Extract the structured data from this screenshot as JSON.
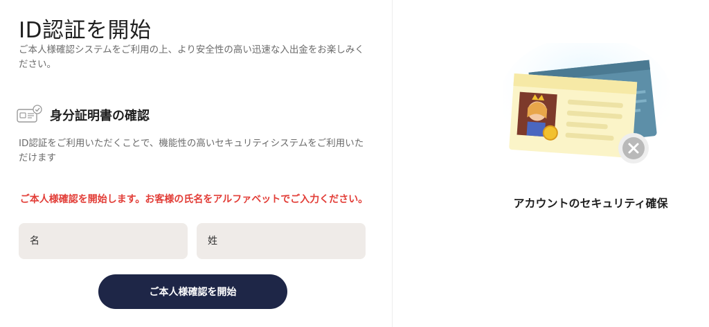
{
  "header": {
    "title": "ID認証を開始",
    "intro": "ご本人様確認システムをご利用の上、より安全性の高い迅速な入出金をお楽しみください。"
  },
  "section": {
    "icon": "id-card-check-icon",
    "title": "身分証明書の確認",
    "description": "ID認証をご利用いただくことで、機能性の高いセキュリティシステムをご利用いただけます"
  },
  "notice": "ご本人様確認を開始します。お客様の氏名をアルファベットでご入力ください。",
  "form": {
    "first_name_placeholder": "名",
    "last_name_placeholder": "姓",
    "first_name_value": "",
    "last_name_value": ""
  },
  "button": {
    "start_label": "ご本人様確認を開始"
  },
  "illustration": {
    "icon": "id-card-illustration",
    "status_icon": "close-circle-icon"
  },
  "security_label": "アカウントのセキュリティ確保",
  "colors": {
    "button_bg": "#1e2647",
    "notice_text": "#e23d37",
    "field_bg": "#efebe8"
  }
}
